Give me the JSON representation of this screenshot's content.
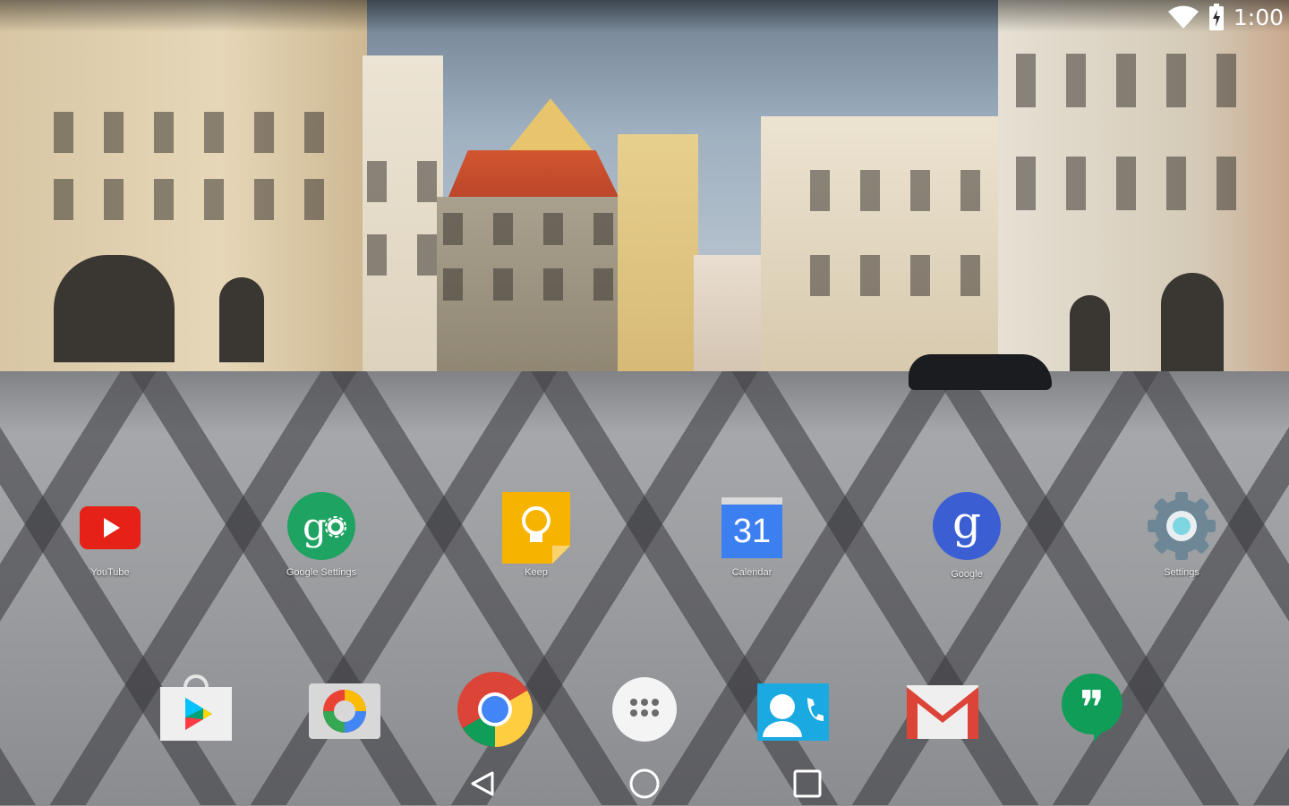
{
  "status_bar": {
    "time": "1:00",
    "icons": [
      "wifi-icon",
      "battery-charging-icon"
    ]
  },
  "home_screen": {
    "apps": [
      {
        "label": "YouTube",
        "icon": "youtube-icon"
      },
      {
        "label": "Google Settings",
        "icon": "google-settings-icon"
      },
      {
        "label": "Keep",
        "icon": "keep-icon"
      },
      {
        "label": "Calendar",
        "icon": "calendar-icon",
        "badge_text": "31"
      },
      {
        "label": "Google",
        "icon": "google-search-icon",
        "glyph": "g"
      },
      {
        "label": "Settings",
        "icon": "settings-gear-icon"
      }
    ]
  },
  "dock": {
    "apps": [
      {
        "name": "Play Store",
        "icon": "play-store-icon"
      },
      {
        "name": "Photos",
        "icon": "photos-icon"
      },
      {
        "name": "Chrome",
        "icon": "chrome-icon"
      },
      {
        "name": "All apps",
        "icon": "app-drawer-icon"
      },
      {
        "name": "Contacts",
        "icon": "contacts-icon"
      },
      {
        "name": "Gmail",
        "icon": "gmail-icon"
      },
      {
        "name": "Hangouts",
        "icon": "hangouts-icon",
        "glyph": "❞"
      }
    ]
  },
  "nav_bar": {
    "buttons": [
      "back-icon",
      "home-icon",
      "recents-icon"
    ]
  },
  "colors": {
    "youtube_red": "#e62117",
    "google_green": "#1ea362",
    "keep_yellow": "#f6b400",
    "calendar_blue": "#3c7ff0",
    "google_blue": "#3b5fd3",
    "settings_gray": "#6d8797",
    "gmail_red": "#db4437",
    "hangouts_green": "#0f9d58"
  }
}
